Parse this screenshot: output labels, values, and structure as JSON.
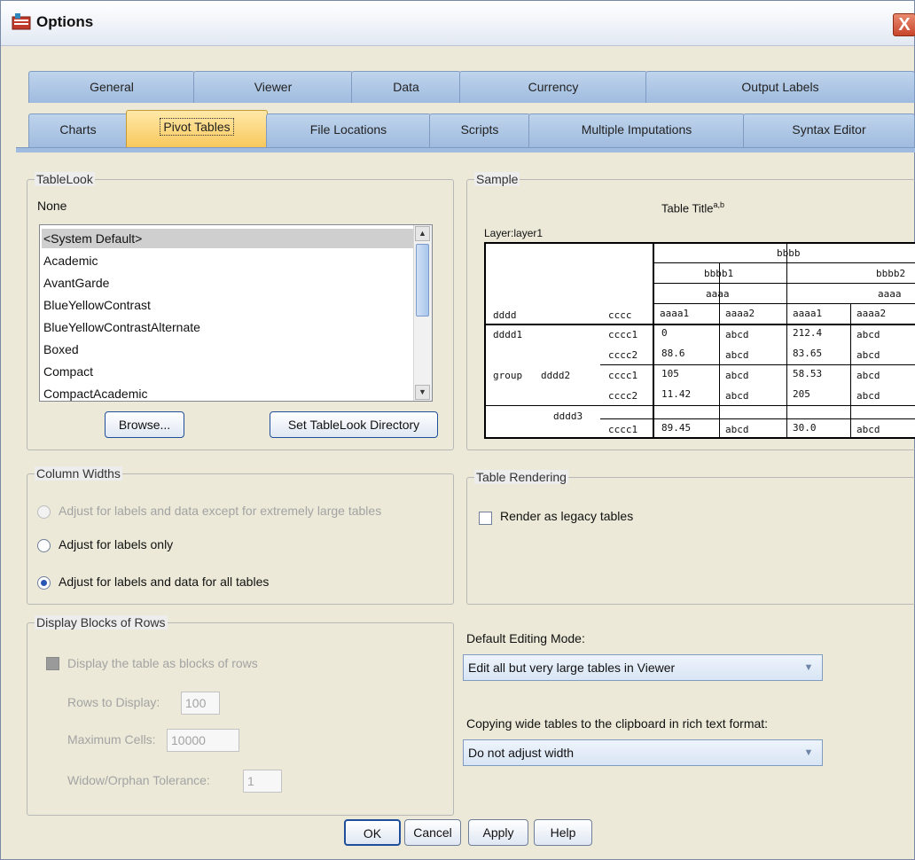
{
  "window": {
    "title": "Options",
    "close_glyph": "X"
  },
  "tabs_row1": [
    {
      "label": "General"
    },
    {
      "label": "Viewer"
    },
    {
      "label": "Data"
    },
    {
      "label": "Currency"
    },
    {
      "label": "Output Labels"
    }
  ],
  "tabs_row2": [
    {
      "label": "Charts"
    },
    {
      "label": "Pivot Tables"
    },
    {
      "label": "File Locations"
    },
    {
      "label": "Scripts"
    },
    {
      "label": "Multiple Imputations"
    },
    {
      "label": "Syntax Editor"
    }
  ],
  "active_tab": "Pivot Tables",
  "tablelook": {
    "legend": "TableLook",
    "current": "None",
    "items": [
      "<System Default>",
      "Academic",
      "AvantGarde",
      "BlueYellowContrast",
      "BlueYellowContrastAlternate",
      "Boxed",
      "Compact",
      "CompactAcademic"
    ],
    "selected": "<System Default>",
    "browse_label": "Browse...",
    "set_dir_label": "Set TableLook Directory"
  },
  "sample": {
    "legend": "Sample",
    "title": "Table Title",
    "title_sup": "a,b",
    "layer": "Layer:layer1",
    "col_top": "bbbb",
    "col_sub1": "bbbb1",
    "col_sub2": "bbbb2",
    "col_aaaa": "aaaa",
    "row_header1": "dddd",
    "row_header2": "cccc",
    "col_aaaa1": "aaaa1",
    "col_aaaa2": "aaaa2",
    "col_aaaa1b": "aaaa1",
    "col_aaaa2b": "aaaa2",
    "group_label": "group",
    "rows": [
      {
        "d": "dddd1",
        "d2": "",
        "c": "cccc1",
        "v1": "0",
        "v2": "abcd",
        "v3": "212.4",
        "v4": "abcd"
      },
      {
        "d": "",
        "d2": "",
        "c": "cccc2",
        "v1": "88.6",
        "v2": "abcd",
        "v3": "83.65",
        "v4": "abcd"
      },
      {
        "d": "",
        "d2": "dddd2",
        "c": "cccc1",
        "v1": "105",
        "v2": "abcd",
        "v3": "58.53",
        "v4": "abcd"
      },
      {
        "d": "",
        "d2": "",
        "c": "cccc2",
        "v1": "11.42",
        "v2": "abcd",
        "v3": "205",
        "v4": "abcd"
      },
      {
        "d": "",
        "d2": "dddd3",
        "c": "cccc1",
        "v1": "89.45",
        "v2": "abcd",
        "v3": "30.0",
        "v4": "abcd"
      }
    ]
  },
  "column_widths": {
    "legend": "Column Widths",
    "option1": "Adjust for labels and data except for extremely large tables",
    "option2": "Adjust for labels only",
    "option3": "Adjust for labels and data for all tables",
    "selected": 3
  },
  "table_rendering": {
    "legend": "Table Rendering",
    "checkbox_label": "Render as legacy tables",
    "checked": false
  },
  "display_blocks": {
    "legend": "Display Blocks of Rows",
    "checkbox_label": "Display the table as blocks of rows",
    "rows_label": "Rows to Display:",
    "rows_value": "100",
    "max_cells_label": "Maximum Cells:",
    "max_cells_value": "10000",
    "widow_label": "Widow/Orphan Tolerance:",
    "widow_value": "1"
  },
  "editing_mode": {
    "label": "Default Editing Mode:",
    "value": "Edit all but very large tables in Viewer"
  },
  "copy_wide": {
    "label": "Copying wide tables to the clipboard in rich text format:",
    "value": "Do not adjust width"
  },
  "buttons": {
    "ok": "OK",
    "cancel": "Cancel",
    "apply": "Apply",
    "help": "Help"
  }
}
